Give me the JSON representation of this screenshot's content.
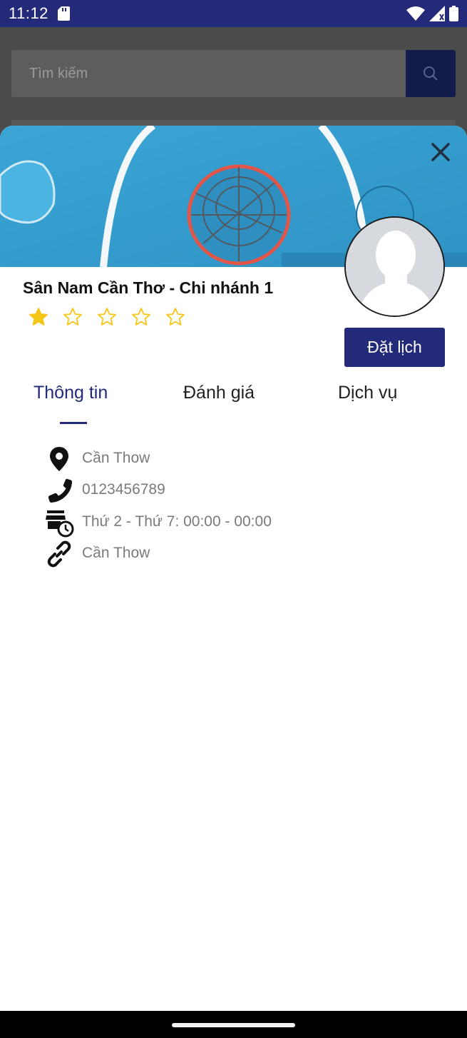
{
  "status_bar": {
    "time": "11:12"
  },
  "search": {
    "placeholder": "Tìm kiếm"
  },
  "venue": {
    "name": "Sân Nam Cần Thơ - Chi nhánh 1",
    "rating": 1,
    "rating_max": 5,
    "book_label": "Đặt lịch"
  },
  "tabs": [
    {
      "label": "Thông tin"
    },
    {
      "label": "Đánh giá"
    },
    {
      "label": "Dịch vụ"
    }
  ],
  "info": [
    {
      "icon": "location-pin-icon",
      "text": "Cần Thow"
    },
    {
      "icon": "phone-icon",
      "text": "0123456789"
    },
    {
      "icon": "store-hours-icon",
      "text": "Thứ 2 - Thứ 7: 00:00 - 00:00"
    },
    {
      "icon": "link-icon",
      "text": "Cần Thow"
    }
  ],
  "colors": {
    "primary": "#232a7a",
    "star": "#f5c518",
    "text_muted": "#7a7a7a"
  }
}
